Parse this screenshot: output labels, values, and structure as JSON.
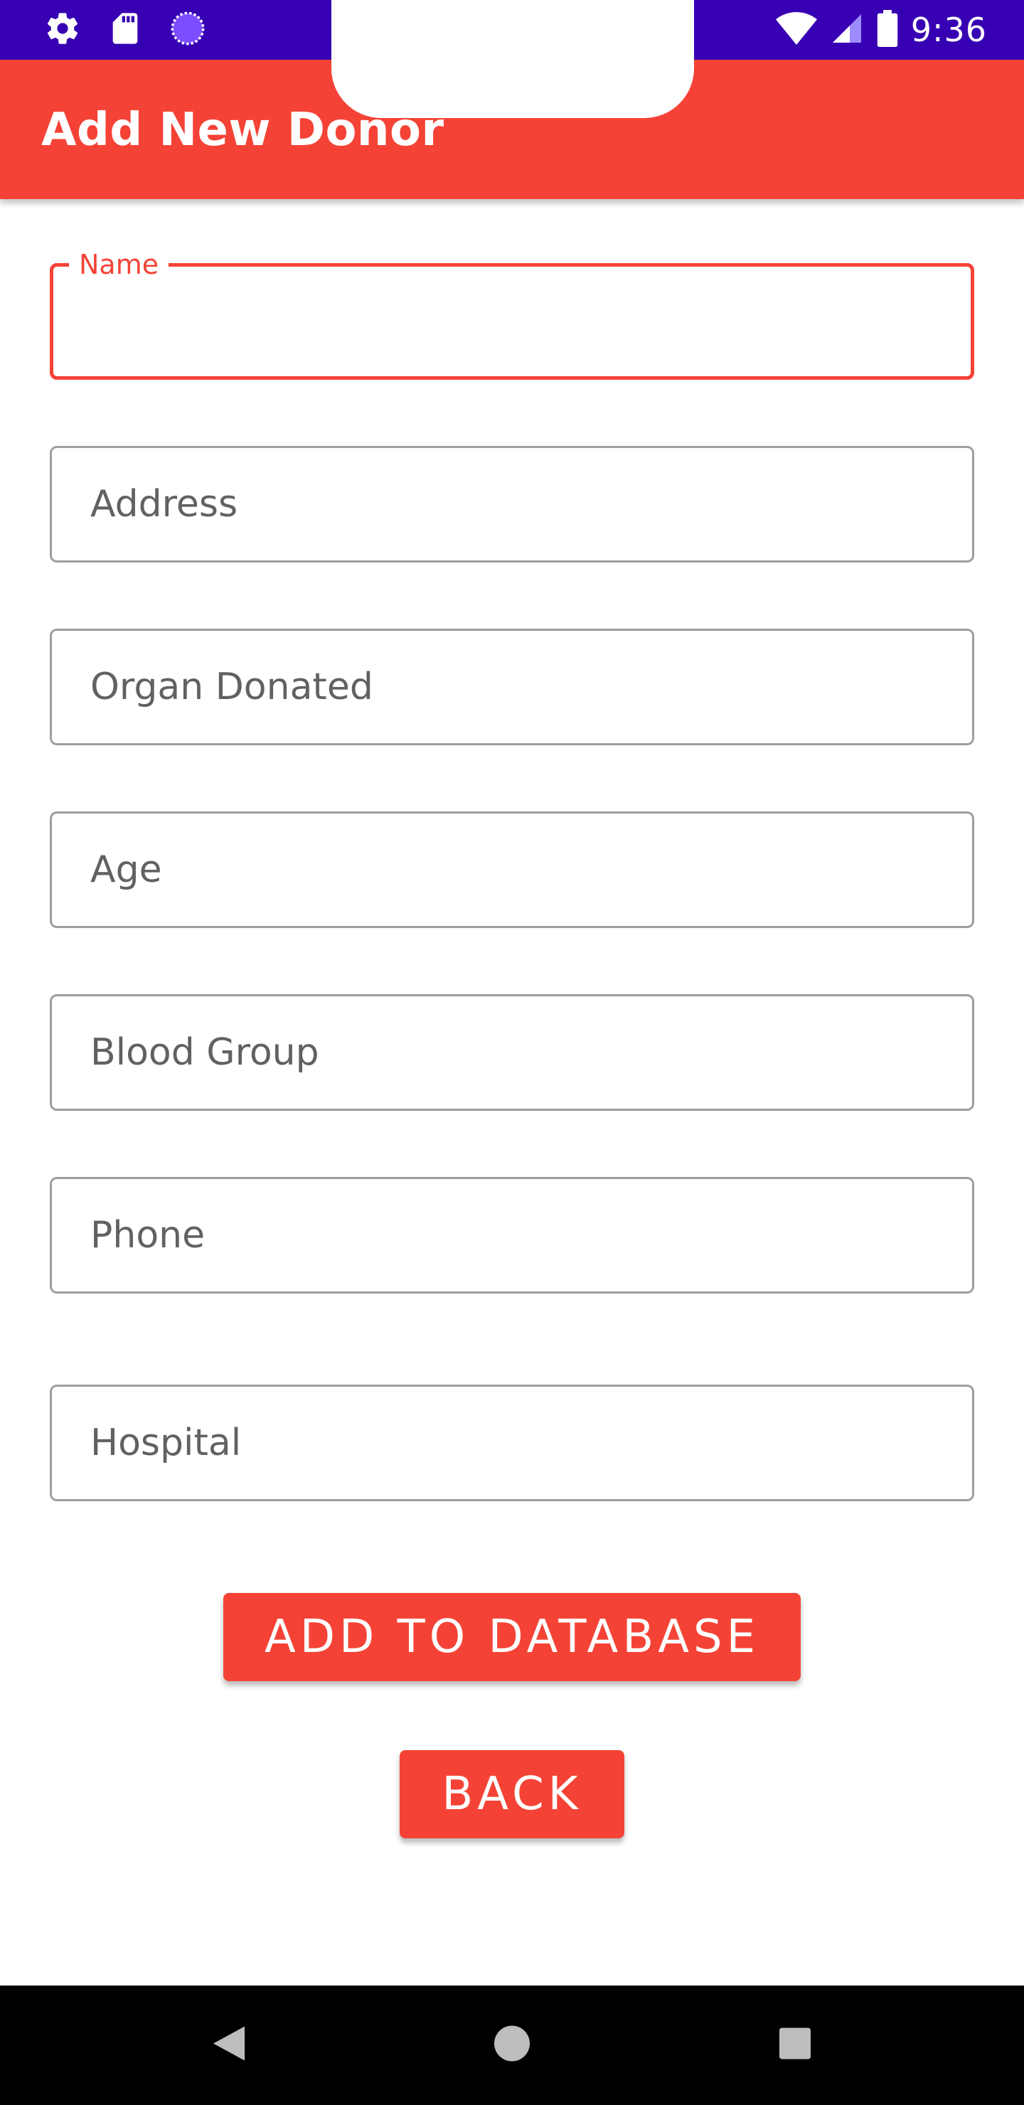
{
  "status_bar": {
    "time": "9:36",
    "icons": [
      "settings-icon",
      "sd-card-icon",
      "loading-icon",
      "wifi-icon",
      "signal-icon",
      "battery-icon"
    ],
    "background_color": "#3700b3"
  },
  "app_bar": {
    "title": "Add New Donor",
    "background_color": "#f44336"
  },
  "form": {
    "fields": [
      {
        "label": "Name",
        "value": "",
        "focused": true
      },
      {
        "placeholder": "Address",
        "value": ""
      },
      {
        "placeholder": "Organ Donated",
        "value": ""
      },
      {
        "placeholder": "Age",
        "value": ""
      },
      {
        "placeholder": "Blood Group",
        "value": ""
      },
      {
        "placeholder": "Phone",
        "value": ""
      },
      {
        "placeholder": "Hospital",
        "value": ""
      }
    ]
  },
  "buttons": {
    "add_label": "ADD TO DATABASE",
    "back_label": "BACK",
    "accent_color": "#f44336"
  },
  "nav_bar": {
    "icons": [
      "back-triangle-icon",
      "home-circle-icon",
      "recents-square-icon"
    ]
  }
}
